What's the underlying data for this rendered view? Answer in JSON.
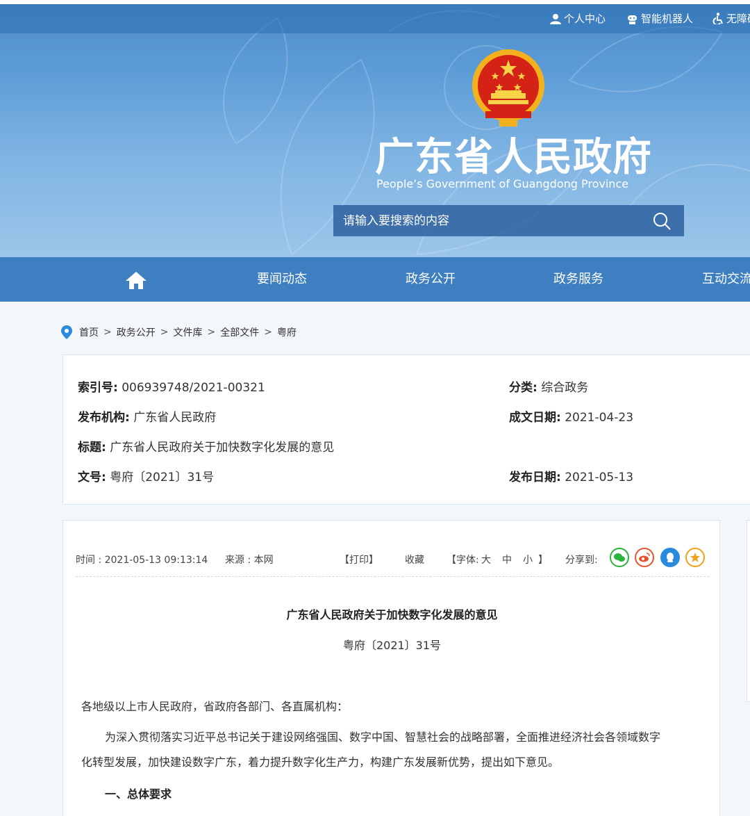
{
  "util": {
    "personal_center": "个人中心",
    "robot": "智能机器人",
    "accessibility": "无障碍"
  },
  "header": {
    "title": "广东省人民政府",
    "subtitle": "People’s Government of Guangdong Province",
    "search_placeholder": "请输入要搜索的内容"
  },
  "nav": {
    "items": [
      "要闻动态",
      "政务公开",
      "政务服务",
      "互动交流"
    ]
  },
  "breadcrumb": [
    "首页",
    "政务公开",
    "文件库",
    "全部文件",
    "粤府"
  ],
  "meta": {
    "index_label": "索引号:",
    "index_value": "006939748/2021-00321",
    "category_label": "分类:",
    "category_value": "综合政务",
    "publisher_label": "发布机构:",
    "publisher_value": "广东省人民政府",
    "written_label": "成文日期:",
    "written_value": "2021-04-23",
    "title_label": "标题:",
    "title_value": "广东省人民政府关于加快数字化发展的意见",
    "docno_label": "文号:",
    "docno_value": "粤府〔2021〕31号",
    "pubdate_label": "发布日期:",
    "pubdate_value": "2021-05-13"
  },
  "toolbar": {
    "time": "时间 : 2021-05-13 09:13:14",
    "source": "来源 : 本网",
    "print": "【打印】",
    "favorite": "收藏",
    "font_label": "【字体:",
    "font_large": "大",
    "font_medium": "中",
    "font_small": "小",
    "font_end": "】",
    "share_label": "分享到:"
  },
  "article": {
    "title": "广东省人民政府关于加快数字化发展的意见",
    "doc_number": "粤府〔2021〕31号",
    "salutation": "各地级以上市人民政府，省政府各部门、各直属机构：",
    "paragraph1_line1": "为深入贯彻落实习近平总书记关于建设网络强国、数字中国、智慧社会的战略部署，全面推进经济社会各领域数字",
    "paragraph1_line2": "化转型发展，加快建设数字广东，着力提升数字化生产力，构建广东发展新优势，提出如下意见。",
    "heading1": "一、总体要求"
  },
  "colors": {
    "nav_blue": "#3d7fc1",
    "wechat_green": "#2cb33a",
    "weibo_red": "#e6542f",
    "qq_blue": "#2a8ae0",
    "star_orange": "#f0a21b"
  }
}
